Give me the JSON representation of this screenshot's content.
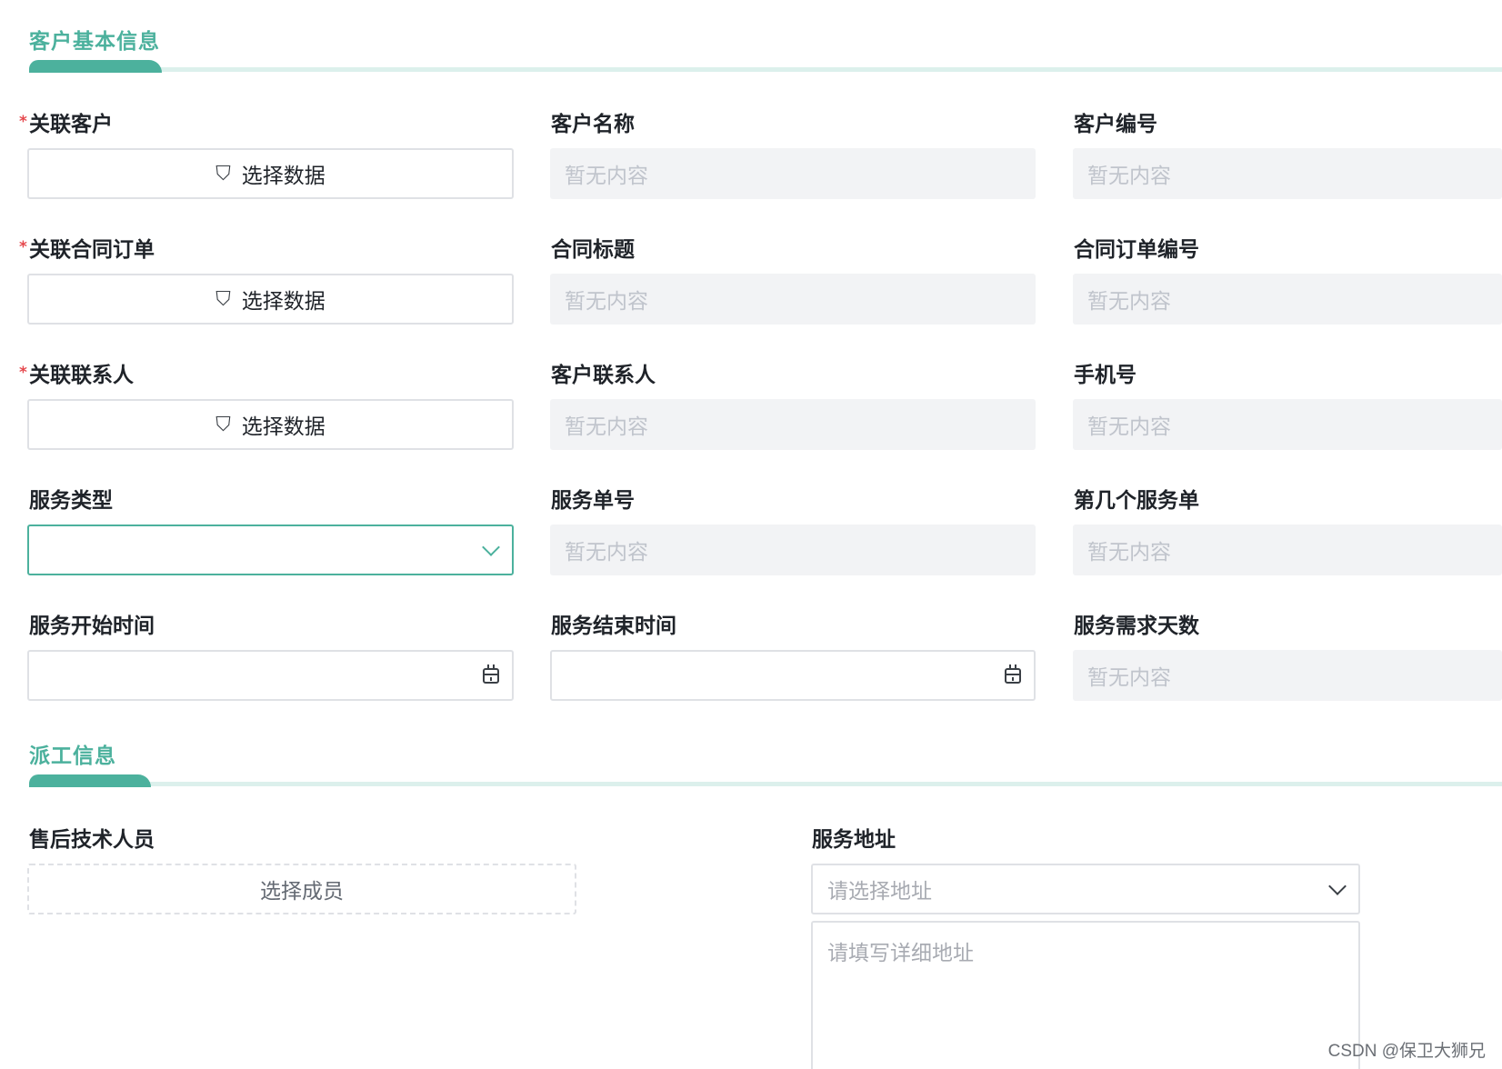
{
  "sections": {
    "customer_info": {
      "title": "客户基本信息"
    },
    "dispatch_info": {
      "title": "派工信息"
    }
  },
  "common": {
    "select_data_label": "选择数据",
    "empty_placeholder": "暂无内容"
  },
  "fields": {
    "related_customer": {
      "label": "关联客户",
      "required_mark": "*"
    },
    "customer_name": {
      "label": "客户名称"
    },
    "customer_code": {
      "label": "客户编号"
    },
    "related_contract_order": {
      "label": "关联合同订单",
      "required_mark": "*"
    },
    "contract_title": {
      "label": "合同标题"
    },
    "contract_order_code": {
      "label": "合同订单编号"
    },
    "related_contact": {
      "label": "关联联系人",
      "required_mark": "*"
    },
    "customer_contact": {
      "label": "客户联系人"
    },
    "mobile": {
      "label": "手机号"
    },
    "service_type": {
      "label": "服务类型",
      "value": ""
    },
    "service_no": {
      "label": "服务单号"
    },
    "nth_service": {
      "label": "第几个服务单"
    },
    "service_start_time": {
      "label": "服务开始时间",
      "value": ""
    },
    "service_end_time": {
      "label": "服务结束时间",
      "value": ""
    },
    "service_days": {
      "label": "服务需求天数"
    },
    "after_sales_tech": {
      "label": "售后技术人员",
      "button_label": "选择成员"
    },
    "service_address": {
      "label": "服务地址",
      "select_placeholder": "请选择地址",
      "detail_placeholder": "请填写详细地址"
    }
  },
  "icons": {
    "select_data": "data-select-icon",
    "dropdown": "chevron-down-icon",
    "date": "calendar-icon"
  },
  "colors": {
    "accent": "#4cb19d",
    "required": "#e5484d",
    "readonly_bg": "#f2f3f5"
  },
  "watermark": "CSDN @保卫大狮兄"
}
